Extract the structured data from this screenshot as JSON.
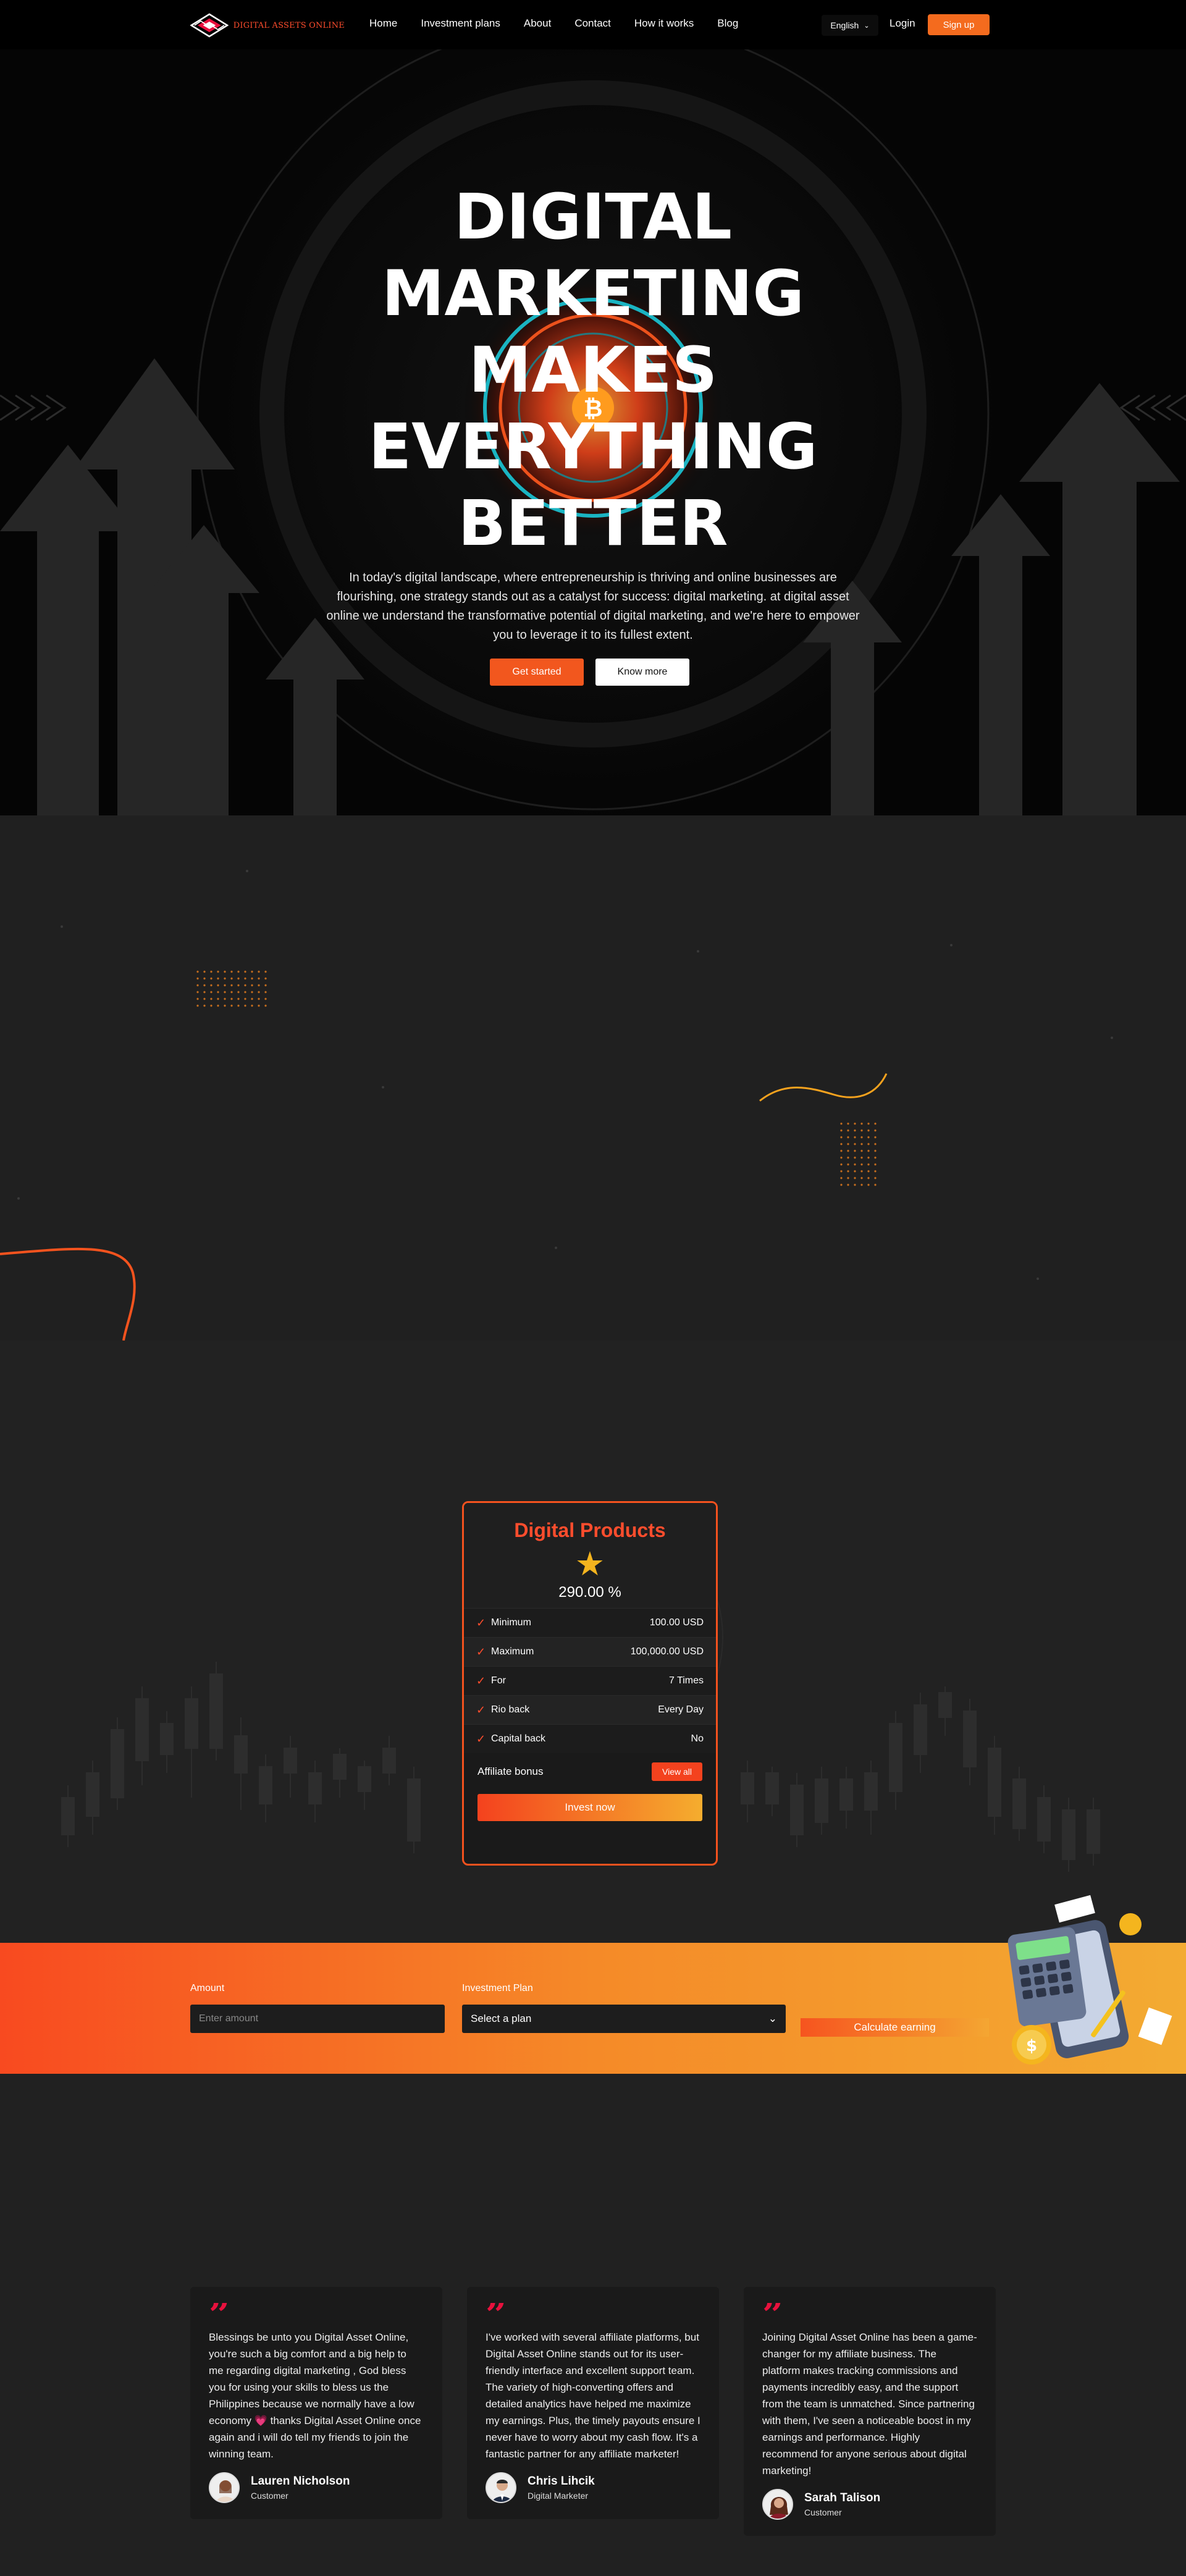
{
  "nav": {
    "brand": "DIGITAL ASSETS ONLINE",
    "links": [
      "Home",
      "Investment plans",
      "About",
      "Contact",
      "How it works",
      "Blog"
    ],
    "language": "English",
    "login": "Login",
    "signup": "Sign up"
  },
  "hero": {
    "title_lines": [
      "DIGITAL",
      "MARKETING",
      "MAKES",
      "EVERYTHING",
      "BETTER"
    ],
    "description": "In today's digital landscape, where entrepreneurship is thriving and online businesses are flourishing, one strategy stands out as a catalyst for success: digital marketing. at digital asset online we understand the transformative potential of digital marketing, and we're here to empower you to leverage it to its fullest extent.",
    "primary_button": "Get started",
    "secondary_button": "Know more"
  },
  "product": {
    "title": "Digital Products",
    "rate": "290.00 %",
    "rows": [
      {
        "label": "Minimum",
        "value": "100.00 USD"
      },
      {
        "label": "Maximum",
        "value": "100,000.00 USD"
      },
      {
        "label": "For",
        "value": "7 Times"
      },
      {
        "label": "Rio back",
        "value": "Every Day"
      },
      {
        "label": "Capital back",
        "value": "No"
      }
    ],
    "bonus_label": "Affiliate bonus",
    "view_all": "View all",
    "invest_button": "Invest now"
  },
  "calculator": {
    "amount_label": "Amount",
    "amount_placeholder": "Enter amount",
    "plan_label": "Investment Plan",
    "plan_selected": "Select a plan",
    "button": "Calculate earning"
  },
  "testimonials": [
    {
      "text": "Blessings be unto you Digital Asset Online, you're such a big comfort and a big help to me regarding digital marketing , God bless you for using your skills to bless us the Philippines because we normally have a low economy 💗 thanks Digital Asset Online once again and i will do tell my friends to join the winning team.",
      "name": "Lauren Nicholson",
      "role": "Customer"
    },
    {
      "text": "I've worked with several affiliate platforms, but Digital Asset Online stands out for its user-friendly interface and excellent support team. The variety of high-converting offers and detailed analytics have helped me maximize my earnings. Plus, the timely payouts ensure I never have to worry about my cash flow. It's a fantastic partner for any affiliate marketer!",
      "name": "Chris Lihcik",
      "role": "Digital Marketer"
    },
    {
      "text": "Joining Digital Asset Online has been a game-changer for my affiliate business. The platform makes tracking commissions and payments incredibly easy, and the support from the team is unmatched. Since partnering with them, I've seen a noticeable boost in my earnings and performance. Highly recommend for anyone serious about digital marketing!",
      "name": "Sarah Talison",
      "role": "Customer"
    }
  ],
  "colors": {
    "accent": "#f4521e",
    "accent_light": "#f5ad2e",
    "quote": "#e8113d"
  }
}
